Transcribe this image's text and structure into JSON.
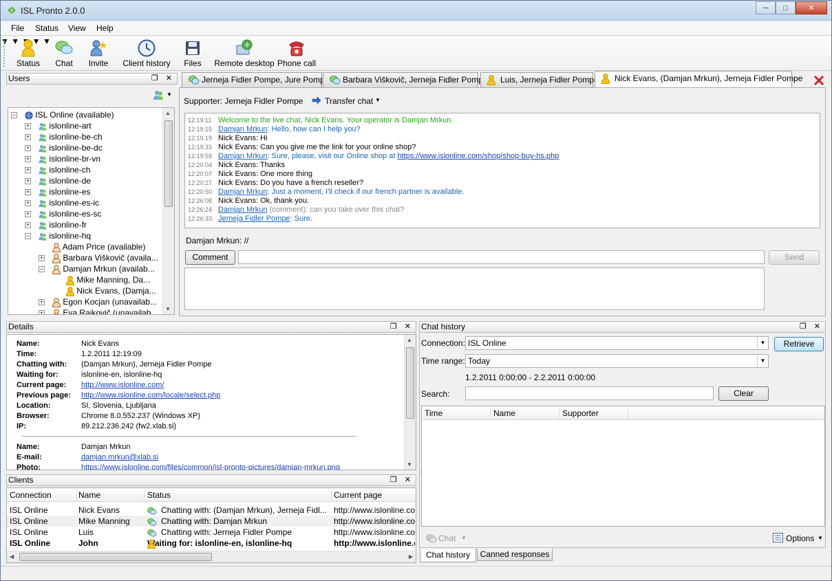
{
  "window": {
    "title": "ISL Pronto 2.0.0"
  },
  "menu": [
    "File",
    "Status",
    "View",
    "Help"
  ],
  "toolbar": {
    "status": "Status",
    "chat": "Chat",
    "invite": "Invite",
    "client_history": "Client history",
    "files": "Files",
    "remote_desktop": "Remote desktop",
    "phone_call": "Phone call"
  },
  "users_panel": {
    "title": "Users",
    "tree": [
      {
        "label": "ISL Online (available)",
        "level": 0,
        "exp": "-"
      },
      {
        "label": "islonline-art",
        "level": 1,
        "exp": "+"
      },
      {
        "label": "islonline-be-ch",
        "level": 1,
        "exp": "+"
      },
      {
        "label": "islonline-be-dc",
        "level": 1,
        "exp": "+"
      },
      {
        "label": "islonline-br-vn",
        "level": 1,
        "exp": "+"
      },
      {
        "label": "islonline-ch",
        "level": 1,
        "exp": "+"
      },
      {
        "label": "islonline-de",
        "level": 1,
        "exp": "+"
      },
      {
        "label": "islonline-es",
        "level": 1,
        "exp": "+"
      },
      {
        "label": "islonline-es-ic",
        "level": 1,
        "exp": "+"
      },
      {
        "label": "islonline-es-sc",
        "level": 1,
        "exp": "+"
      },
      {
        "label": "islonline-fr",
        "level": 1,
        "exp": "+"
      },
      {
        "label": "islonline-hq",
        "level": 1,
        "exp": "-"
      },
      {
        "label": "Adam Price (available)",
        "level": 2,
        "exp": ""
      },
      {
        "label": "Barbara Viškovič (availa...",
        "level": 2,
        "exp": "+"
      },
      {
        "label": "Damjan Mrkun (availab...",
        "level": 2,
        "exp": "-"
      },
      {
        "label": "Mike Manning, Da...",
        "level": 3,
        "exp": ""
      },
      {
        "label": "Nick Evans, (Damja...",
        "level": 3,
        "exp": ""
      },
      {
        "label": "Egon Kocjan (unavailab...",
        "level": 2,
        "exp": "+"
      },
      {
        "label": "Eva Rajkovič (unavailab...",
        "level": 2,
        "exp": "+"
      }
    ]
  },
  "tabs": [
    {
      "label": "Jerneja Fidler Pompe, Jure Pompe"
    },
    {
      "label": "Barbara Viškovič, Jerneja Fidler Pompe"
    },
    {
      "label": "Luis, Jerneja Fidler Pompe"
    },
    {
      "label": "Nick Evans, (Damjan Mrkun), Jerneja Fidler Pompe"
    }
  ],
  "chat": {
    "supporter": "Supporter: Jerneja Fidler Pompe",
    "transfer": "Transfer chat",
    "messages": [
      {
        "t": "12:19:11",
        "who": "",
        "text": "Welcome to the live chat, Nick Evans. Your operator is Damjan Mrkun.",
        "style": "g"
      },
      {
        "t": "12:19:15",
        "who": "Damjan Mrkun",
        "text": ": Hello, how can I help you?",
        "style": "b"
      },
      {
        "t": "12:19:19",
        "who": "",
        "text": "Nick Evans: Hi",
        "style": ""
      },
      {
        "t": "12:19:33",
        "who": "",
        "text": "Nick Evans: Can you give me the link for your online shop?",
        "style": ""
      },
      {
        "t": "12:19:59",
        "who": "Damjan Mrkun",
        "text": ": Sure, please, visit our Online shop at ",
        "link": "https://www.islonline.com/shop/shop-buy-hs.php",
        "style": "b"
      },
      {
        "t": "12:20:04",
        "who": "",
        "text": "Nick Evans: Thanks",
        "style": ""
      },
      {
        "t": "12:20:07",
        "who": "",
        "text": "Nick Evans: One more thing",
        "style": ""
      },
      {
        "t": "12:20:27",
        "who": "",
        "text": "Nick Evans: Do you have a french reseller?",
        "style": ""
      },
      {
        "t": "12:20:50",
        "who": "Damjan Mrkun",
        "text": ": Just a moment, I'll check if our french partner is available.",
        "style": "b"
      },
      {
        "t": "12:26:08",
        "who": "",
        "text": "Nick Evans: Ok, thank you.",
        "style": ""
      },
      {
        "t": "12:26:24",
        "who": "Damjan Mrkun",
        "text": " (comment): can you take over this chat?",
        "style": "gr"
      },
      {
        "t": "12:26:33",
        "who": "Jerneja Fidler Pompe",
        "text": ": Sure.",
        "style": "b"
      }
    ],
    "typing": "Damjan Mrkun: //",
    "comment_btn": "Comment",
    "send_btn": "Send"
  },
  "details": {
    "title": "Details",
    "rows": [
      {
        "k": "Name:",
        "v": "Nick Evans"
      },
      {
        "k": "Time:",
        "v": "1.2.2011 12:19:09"
      },
      {
        "k": "Chatting with:",
        "v": "(Damjan Mrkun), Jerneja Fidler Pompe"
      },
      {
        "k": "Waiting for:",
        "v": "islonline-en, islonline-hq"
      },
      {
        "k": "Current page:",
        "v": "http://www.islonline.com/",
        "link": true
      },
      {
        "k": "Previous page:",
        "v": "http://www.islonline.com/locale/select.php",
        "link": true
      },
      {
        "k": "Location:",
        "v": "SI, Slovenia, Ljubljana"
      },
      {
        "k": "Browser:",
        "v": "Chrome 8.0.552.237 (Windows XP)"
      },
      {
        "k": "IP:",
        "v": "89.212.236.242 (fw2.xlab.si)"
      }
    ],
    "rows2": [
      {
        "k": "Name:",
        "v": "Damjan Mrkun"
      },
      {
        "k": "E-mail:",
        "v": "damjan.mrkun@xlab.si",
        "link": true
      },
      {
        "k": "Photo:",
        "v": "https://www.islonline.com/files/common/isl-pronto-pictures/damjan-mrkun.png",
        "link": true
      }
    ]
  },
  "clients": {
    "title": "Clients",
    "cols": [
      "Connection",
      "Name",
      "Status",
      "Current page"
    ],
    "rows": [
      {
        "c": "ISL Online",
        "n": "Nick Evans",
        "s": "Chatting with: (Damjan Mrkun), Jerneja Fidl...",
        "p": "http://www.islonline.co",
        "bold": false
      },
      {
        "c": "ISL Online",
        "n": "Mike Manning",
        "s": "Chatting with: Damjan Mrkun",
        "p": "http://www.islonline.co",
        "bold": false
      },
      {
        "c": "ISL Online",
        "n": "Luis",
        "s": "Chatting with: Jerneja Fidler Pompe",
        "p": "http://www.islonline.co",
        "bold": false
      },
      {
        "c": "ISL Online",
        "n": "John",
        "s": "Waiting for: islonline-en, islonline-hq",
        "p": "http://www.islonline.co",
        "bold": true
      }
    ]
  },
  "history": {
    "title": "Chat history",
    "connection_label": "Connection:",
    "connection_value": "ISL Online",
    "range_label": "Time range:",
    "range_value": "Today",
    "range_text": "1.2.2011 0:00:00 - 2.2.2011 0:00:00",
    "search_label": "Search:",
    "search_value": "",
    "retrieve": "Retrieve",
    "clear": "Clear",
    "cols": [
      "Time",
      "Name",
      "Supporter"
    ],
    "chat_btn": "Chat",
    "options_btn": "Options",
    "bottom_tabs": [
      "Chat history",
      "Canned responses"
    ]
  }
}
